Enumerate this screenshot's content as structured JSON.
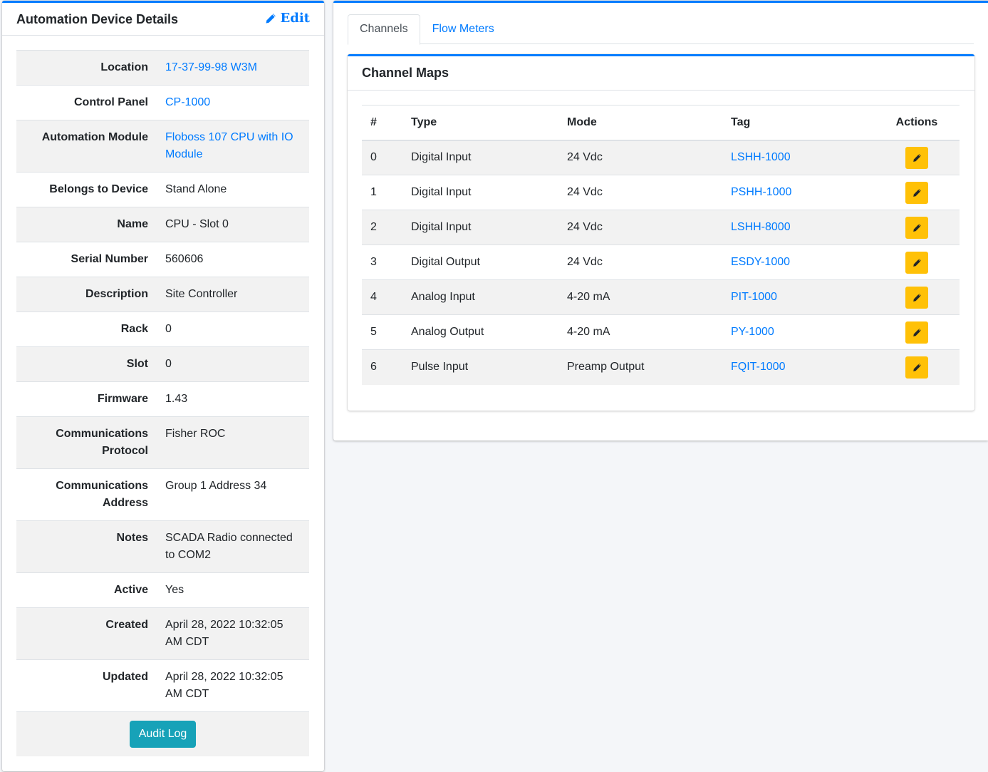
{
  "device_card": {
    "title": "Automation Device Details",
    "edit_label": "Edit",
    "fields": [
      {
        "label": "Location",
        "value": "17-37-99-98 W3M",
        "link": true
      },
      {
        "label": "Control Panel",
        "value": "CP-1000",
        "link": true
      },
      {
        "label": "Automation Module",
        "value": "Floboss 107 CPU with IO Module",
        "link": true
      },
      {
        "label": "Belongs to Device",
        "value": "Stand Alone",
        "link": false
      },
      {
        "label": "Name",
        "value": "CPU - Slot 0",
        "link": false
      },
      {
        "label": "Serial Number",
        "value": "560606",
        "link": false
      },
      {
        "label": "Description",
        "value": "Site Controller",
        "link": false
      },
      {
        "label": "Rack",
        "value": "0",
        "link": false
      },
      {
        "label": "Slot",
        "value": "0",
        "link": false
      },
      {
        "label": "Firmware",
        "value": "1.43",
        "link": false
      },
      {
        "label": "Communications Protocol",
        "value": "Fisher ROC",
        "link": false
      },
      {
        "label": "Communications Address",
        "value": "Group 1 Address 34",
        "link": false
      },
      {
        "label": "Notes",
        "value": "SCADA Radio connected to COM2",
        "link": false
      },
      {
        "label": "Active",
        "value": "Yes",
        "link": false
      },
      {
        "label": "Created",
        "value": "April 28, 2022 10:32:05 AM CDT",
        "link": false
      },
      {
        "label": "Updated",
        "value": "April 28, 2022 10:32:05 AM CDT",
        "link": false
      }
    ],
    "audit_log_label": "Audit Log"
  },
  "tabs": [
    {
      "label": "Channels",
      "active": true
    },
    {
      "label": "Flow Meters",
      "active": false
    }
  ],
  "channel_maps": {
    "title": "Channel Maps",
    "columns": [
      "#",
      "Type",
      "Mode",
      "Tag",
      "Actions"
    ],
    "rows": [
      {
        "num": "0",
        "type": "Digital Input",
        "mode": "24 Vdc",
        "tag": "LSHH-1000"
      },
      {
        "num": "1",
        "type": "Digital Input",
        "mode": "24 Vdc",
        "tag": "PSHH-1000"
      },
      {
        "num": "2",
        "type": "Digital Input",
        "mode": "24 Vdc",
        "tag": "LSHH-8000"
      },
      {
        "num": "3",
        "type": "Digital Output",
        "mode": "24 Vdc",
        "tag": "ESDY-1000"
      },
      {
        "num": "4",
        "type": "Analog Input",
        "mode": "4-20 mA",
        "tag": "PIT-1000"
      },
      {
        "num": "5",
        "type": "Analog Output",
        "mode": "4-20 mA",
        "tag": "PY-1000"
      },
      {
        "num": "6",
        "type": "Pulse Input",
        "mode": "Preamp Output",
        "tag": "FQIT-1000"
      }
    ],
    "action_icon": "pencil-icon"
  },
  "colors": {
    "primary": "#007bff",
    "info": "#17a2b8",
    "warning": "#ffc107",
    "background": "#f4f6f9"
  }
}
